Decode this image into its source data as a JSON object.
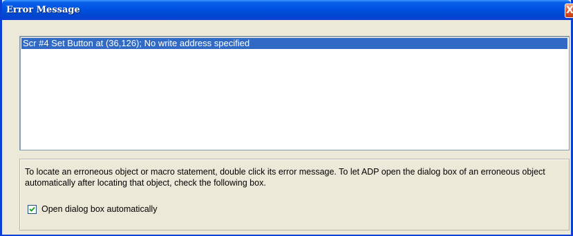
{
  "window": {
    "title": "Error Message",
    "close_glyph": "X",
    "colors": {
      "titlebar": "#0054e3",
      "selection": "#316ac5",
      "face": "#ece9d8",
      "close": "#e05a30"
    }
  },
  "errors": {
    "items": [
      {
        "text": "Scr #4 Set Button at (36,126); No write address specified",
        "selected": true
      }
    ]
  },
  "info": {
    "instructions": "To locate an erroneous object or macro statement, double click its error message. To let ADP open the dialog box of an erroneous object automatically after locating that object, check the following box.",
    "checkbox_label": "Open dialog box automatically",
    "checkbox_checked": true
  }
}
